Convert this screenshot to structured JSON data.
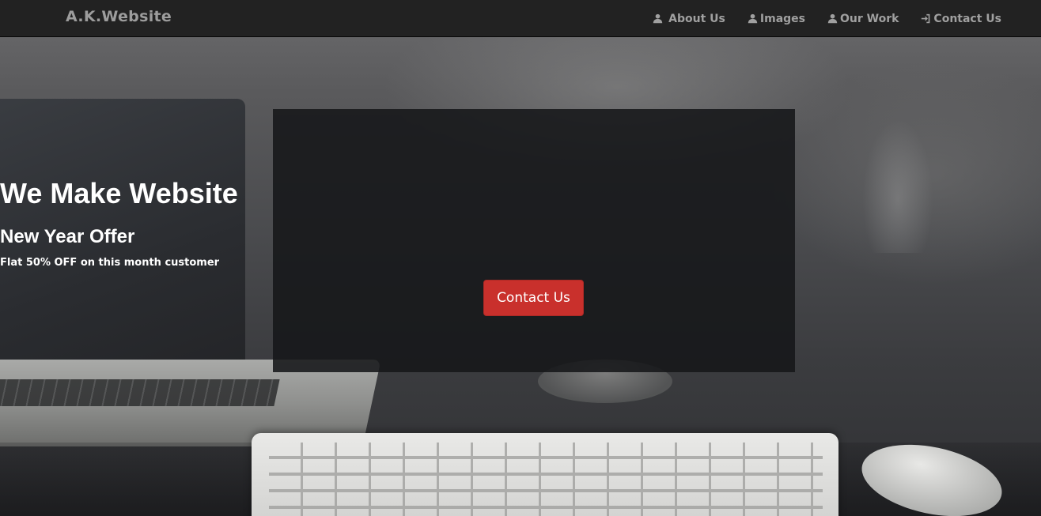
{
  "navbar": {
    "brand": "A.K.Website",
    "items": [
      {
        "label": "About Us",
        "icon": "user-icon"
      },
      {
        "label": "Images",
        "icon": "user-icon"
      },
      {
        "label": "Our Work",
        "icon": "user-icon"
      },
      {
        "label": "Contact Us",
        "icon": "log-in-icon"
      }
    ]
  },
  "hero": {
    "title": "We Make Website",
    "subtitle": "New Year Offer",
    "offer": "Flat 50% OFF on this month customer",
    "button_label": "Contact Us"
  },
  "colors": {
    "navbar_bg": "#222222",
    "nav_text": "#9d9d9d",
    "hero_panel": "#161719",
    "button_bg": "#c9302c"
  }
}
